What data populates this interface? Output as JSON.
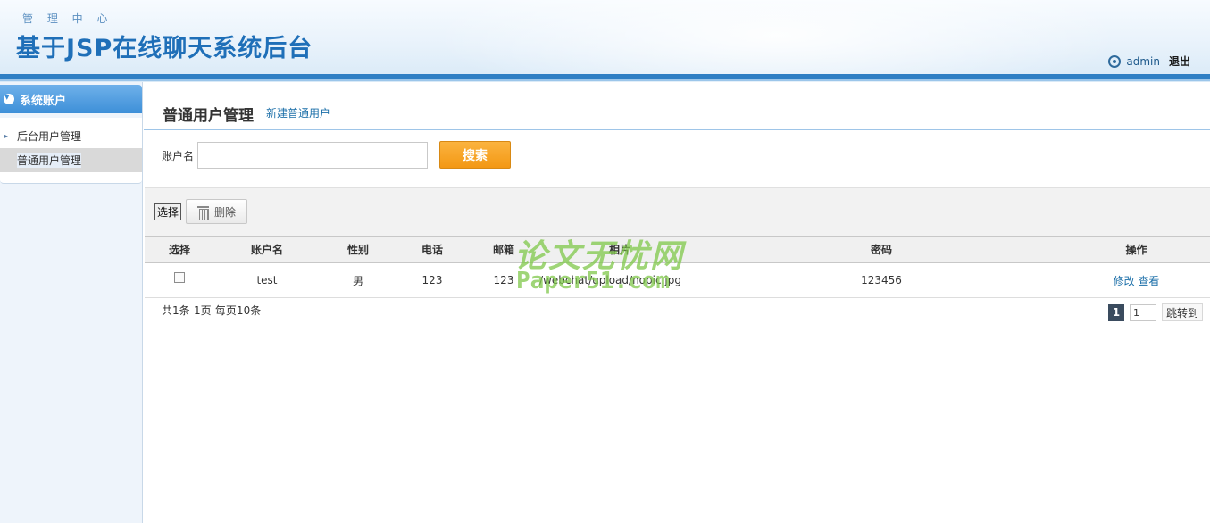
{
  "header": {
    "subtitle": "管 理 中 心",
    "title": "基于JSP在线聊天系统后台",
    "username": "admin",
    "logout": "退出"
  },
  "sidebar": {
    "section_title": "系统账户",
    "items": [
      {
        "label": "后台用户管理",
        "active": false
      },
      {
        "label": "普通用户管理",
        "active": true
      }
    ]
  },
  "main": {
    "page_title": "普通用户管理",
    "new_link": "新建普通用户",
    "search": {
      "label": "账户名",
      "value": "",
      "button": "搜索"
    },
    "toolbar": {
      "select": "选择",
      "delete": "删除"
    },
    "table": {
      "headers": [
        "选择",
        "账户名",
        "性别",
        "电话",
        "邮箱",
        "相片",
        "密码",
        "操作"
      ],
      "rows": [
        {
          "username": "test",
          "gender": "男",
          "phone": "123",
          "email": "123",
          "photo": "/webchat/upload/nopic.jpg",
          "password": "123456",
          "edit": "修改",
          "view": "查看"
        }
      ]
    },
    "summary": "共1条-1页-每页10条",
    "pager": {
      "current": "1",
      "input_value": "1",
      "go": "跳转到"
    }
  },
  "watermark": {
    "line1": "论文无忧网",
    "line2": "Paper51.com"
  },
  "colors": {
    "accent": "#2f7fc4",
    "search_button": "#f39814",
    "link": "#1a6ea8",
    "watermark": "#7fc84a"
  }
}
